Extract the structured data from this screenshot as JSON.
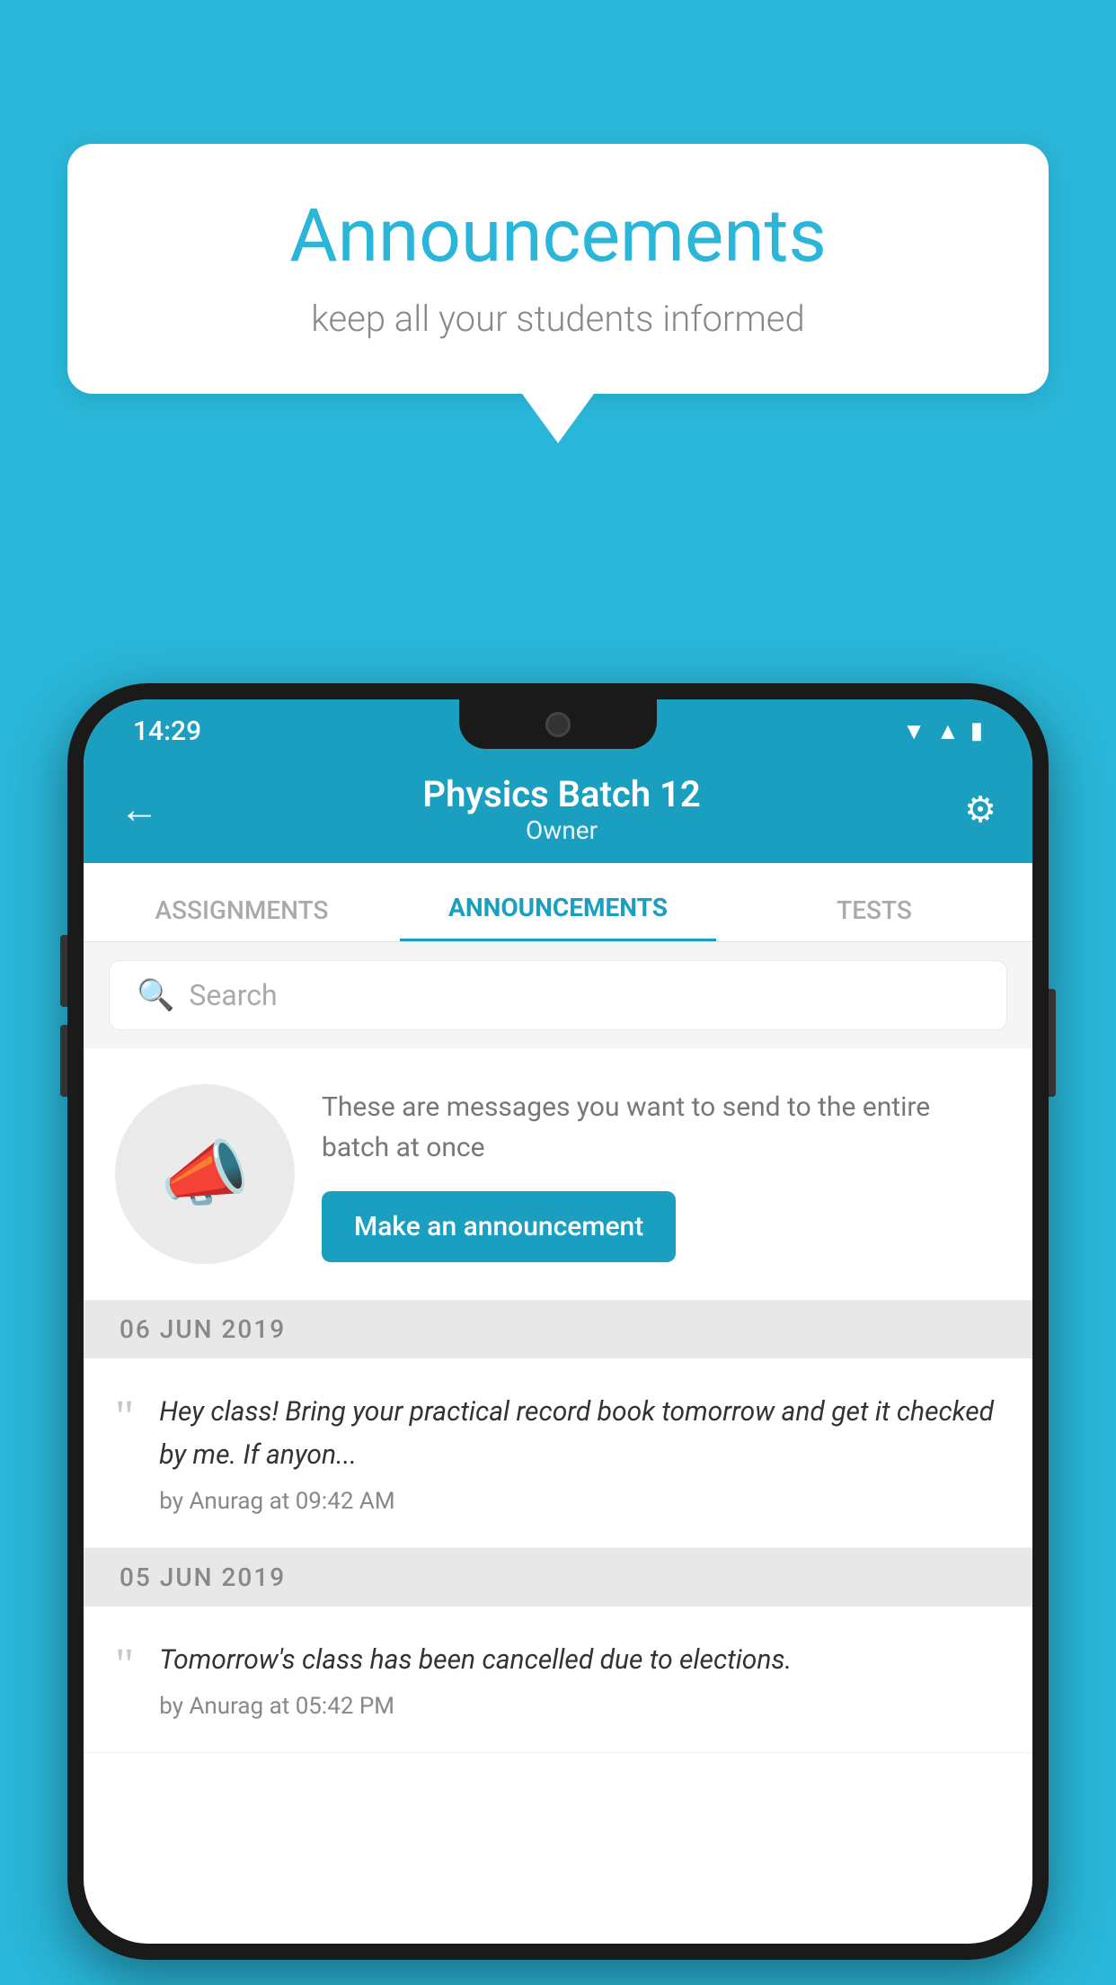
{
  "background_color": "#29b6d8",
  "speech_bubble": {
    "title": "Announcements",
    "subtitle": "keep all your students informed"
  },
  "phone": {
    "status_bar": {
      "time": "14:29",
      "icons": [
        "wifi",
        "signal",
        "battery"
      ]
    },
    "app_bar": {
      "title": "Physics Batch 12",
      "subtitle": "Owner",
      "back_label": "←",
      "settings_label": "⚙"
    },
    "tabs": [
      {
        "label": "ASSIGNMENTS",
        "active": false
      },
      {
        "label": "ANNOUNCEMENTS",
        "active": true
      },
      {
        "label": "TESTS",
        "active": false
      }
    ],
    "search": {
      "placeholder": "Search"
    },
    "promo": {
      "description": "These are messages you want to send to the entire batch at once",
      "button_label": "Make an announcement"
    },
    "announcements": [
      {
        "date": "06  JUN  2019",
        "text": "Hey class! Bring your practical record book tomorrow and get it checked by me. If anyon...",
        "meta": "by Anurag at 09:42 AM"
      },
      {
        "date": "05  JUN  2019",
        "text": "Tomorrow's class has been cancelled due to elections.",
        "meta": "by Anurag at 05:42 PM"
      }
    ]
  }
}
